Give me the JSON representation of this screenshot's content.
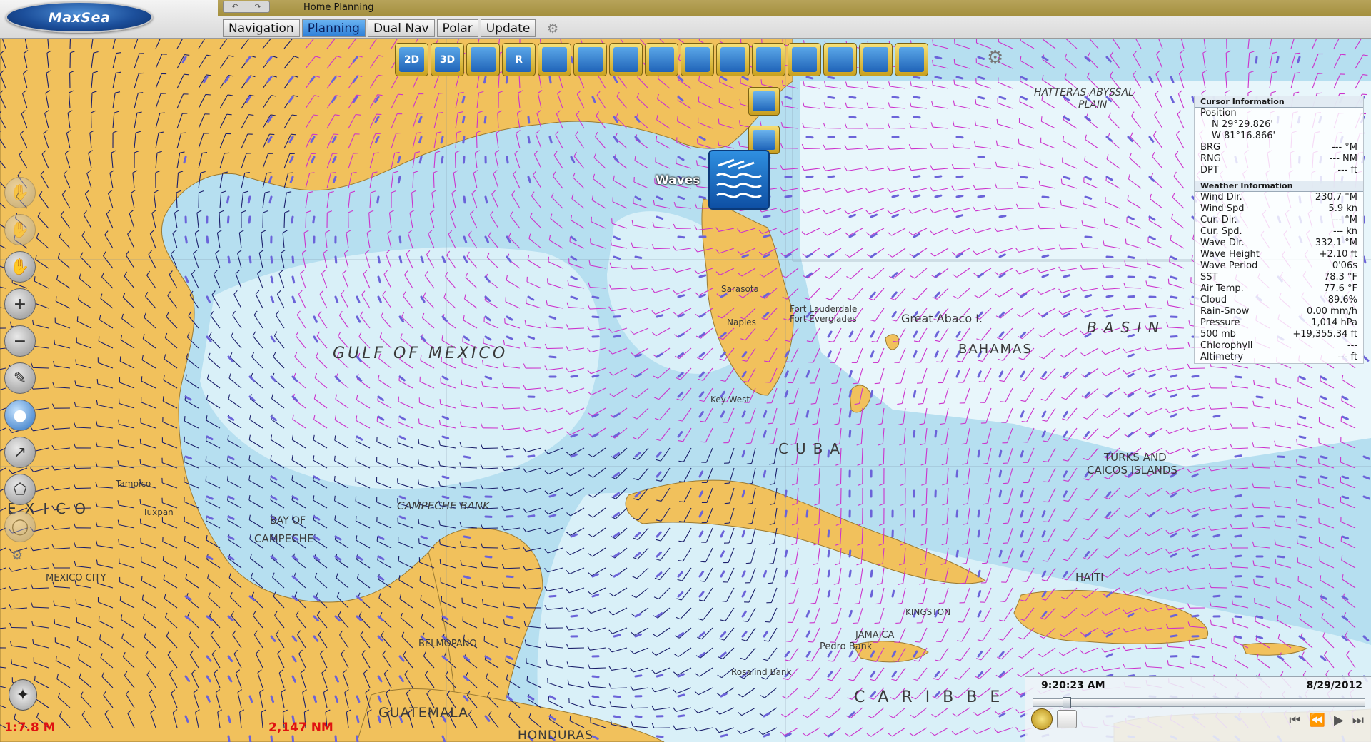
{
  "app": {
    "logo_text": "MaxSea",
    "document_title": "Home Planning"
  },
  "tabs": [
    {
      "label": "Navigation",
      "active": false
    },
    {
      "label": "Planning",
      "active": true
    },
    {
      "label": "Dual Nav",
      "active": false
    },
    {
      "label": "Polar",
      "active": false
    },
    {
      "label": "Update",
      "active": false
    }
  ],
  "toolbar": {
    "tools": [
      {
        "icon": "2d-view-icon",
        "text": "2D"
      },
      {
        "icon": "3d-view-icon",
        "text": "3D"
      },
      {
        "icon": "raster-chart-icon",
        "text": ""
      },
      {
        "icon": "route-icon",
        "text": "R"
      },
      {
        "icon": "satellite-photo-icon",
        "text": ""
      },
      {
        "icon": "terrain-icon",
        "text": ""
      },
      {
        "icon": "ruler-icon",
        "text": ""
      },
      {
        "icon": "tide-icon",
        "text": ""
      },
      {
        "icon": "current-icon",
        "text": ""
      },
      {
        "icon": "weather-grid-icon",
        "text": ""
      },
      {
        "icon": "weather-download-icon",
        "text": ""
      },
      {
        "icon": "overlay-icon",
        "text": ""
      },
      {
        "icon": "layers-icon",
        "text": ""
      },
      {
        "icon": "legend-icon",
        "text": ""
      },
      {
        "icon": "buoy-icon",
        "text": ""
      }
    ]
  },
  "waves_button": {
    "label": "Waves"
  },
  "map_labels": [
    {
      "text": "GULF OF MEXICO"
    },
    {
      "text": "BAHAMAS"
    },
    {
      "text": "Great Abaco I."
    },
    {
      "text": "CUBA"
    },
    {
      "text": "TURKS AND"
    },
    {
      "text": "CAICOS ISLANDS"
    },
    {
      "text": "BASIN"
    },
    {
      "text": "CAMPECHE BANK"
    },
    {
      "text": "BAY OF"
    },
    {
      "text": "CAMPECHE"
    },
    {
      "text": "MEXICO CITY"
    },
    {
      "text": "BELMOPANO"
    },
    {
      "text": "GUATEMALA"
    },
    {
      "text": "HONDURAS"
    },
    {
      "text": "HAITI"
    },
    {
      "text": "KINGSTON"
    },
    {
      "text": "JAMAICA"
    },
    {
      "text": "CARIBBE"
    },
    {
      "text": "EXICO"
    },
    {
      "text": "HATTERAS ABYSSAL"
    },
    {
      "text": "PLAIN"
    },
    {
      "text": "Fort Lauderdale"
    },
    {
      "text": "Fort Everglades"
    },
    {
      "text": "Key West"
    },
    {
      "text": "Sarasota"
    },
    {
      "text": "Naples"
    },
    {
      "text": "Pedro Bank"
    },
    {
      "text": "Rosalind Bank"
    },
    {
      "text": "Tampico"
    },
    {
      "text": "Tuxpan"
    }
  ],
  "cursor_info": {
    "title": "Cursor Information",
    "position_label": "Position",
    "lat": "N 29°29.826'",
    "lon": "W 81°16.866'",
    "rows": [
      {
        "label": "BRG",
        "value": "--- °M"
      },
      {
        "label": "RNG",
        "value": "--- NM"
      },
      {
        "label": "DPT",
        "value": "--- ft"
      }
    ]
  },
  "weather_info": {
    "title": "Weather Information",
    "rows": [
      {
        "label": "Wind Dir.",
        "value": "230.7 °M"
      },
      {
        "label": "Wind Spd",
        "value": "5.9 kn"
      },
      {
        "label": "Cur. Dir.",
        "value": "--- °M"
      },
      {
        "label": "Cur. Spd.",
        "value": "--- kn"
      },
      {
        "label": "Wave Dir.",
        "value": "332.1 °M"
      },
      {
        "label": "Wave Height",
        "value": "+2.10 ft"
      },
      {
        "label": "Wave Period",
        "value": "0'06s"
      },
      {
        "label": "SST",
        "value": "78.3 °F"
      },
      {
        "label": "Air Temp.",
        "value": "77.6 °F"
      },
      {
        "label": "Cloud",
        "value": "89.6%"
      },
      {
        "label": "Rain-Snow",
        "value": "0.00 mm/h"
      },
      {
        "label": "Pressure",
        "value": "1,014 hPa"
      },
      {
        "label": "500 mb",
        "value": "+19,355.34 ft"
      },
      {
        "label": "Chlorophyll",
        "value": "---"
      },
      {
        "label": "Altimetry",
        "value": "--- ft"
      }
    ]
  },
  "status": {
    "scale": "1:7.8 M",
    "distance": "2,147 NM"
  },
  "timebar": {
    "time": "9:20:23 AM",
    "date": "8/29/2012",
    "position": 0.09
  },
  "colors": {
    "land": "#f1c15c",
    "sea": "#b6dff0",
    "deep_sea": "#d9f0f8",
    "wind_barb_magenta": "#cc33cc",
    "wind_barb_navy": "#1b1f6b",
    "wave_arrow": "#6b63d9",
    "accent_tab": "#2e7fd7",
    "status_red": "#e01111"
  }
}
